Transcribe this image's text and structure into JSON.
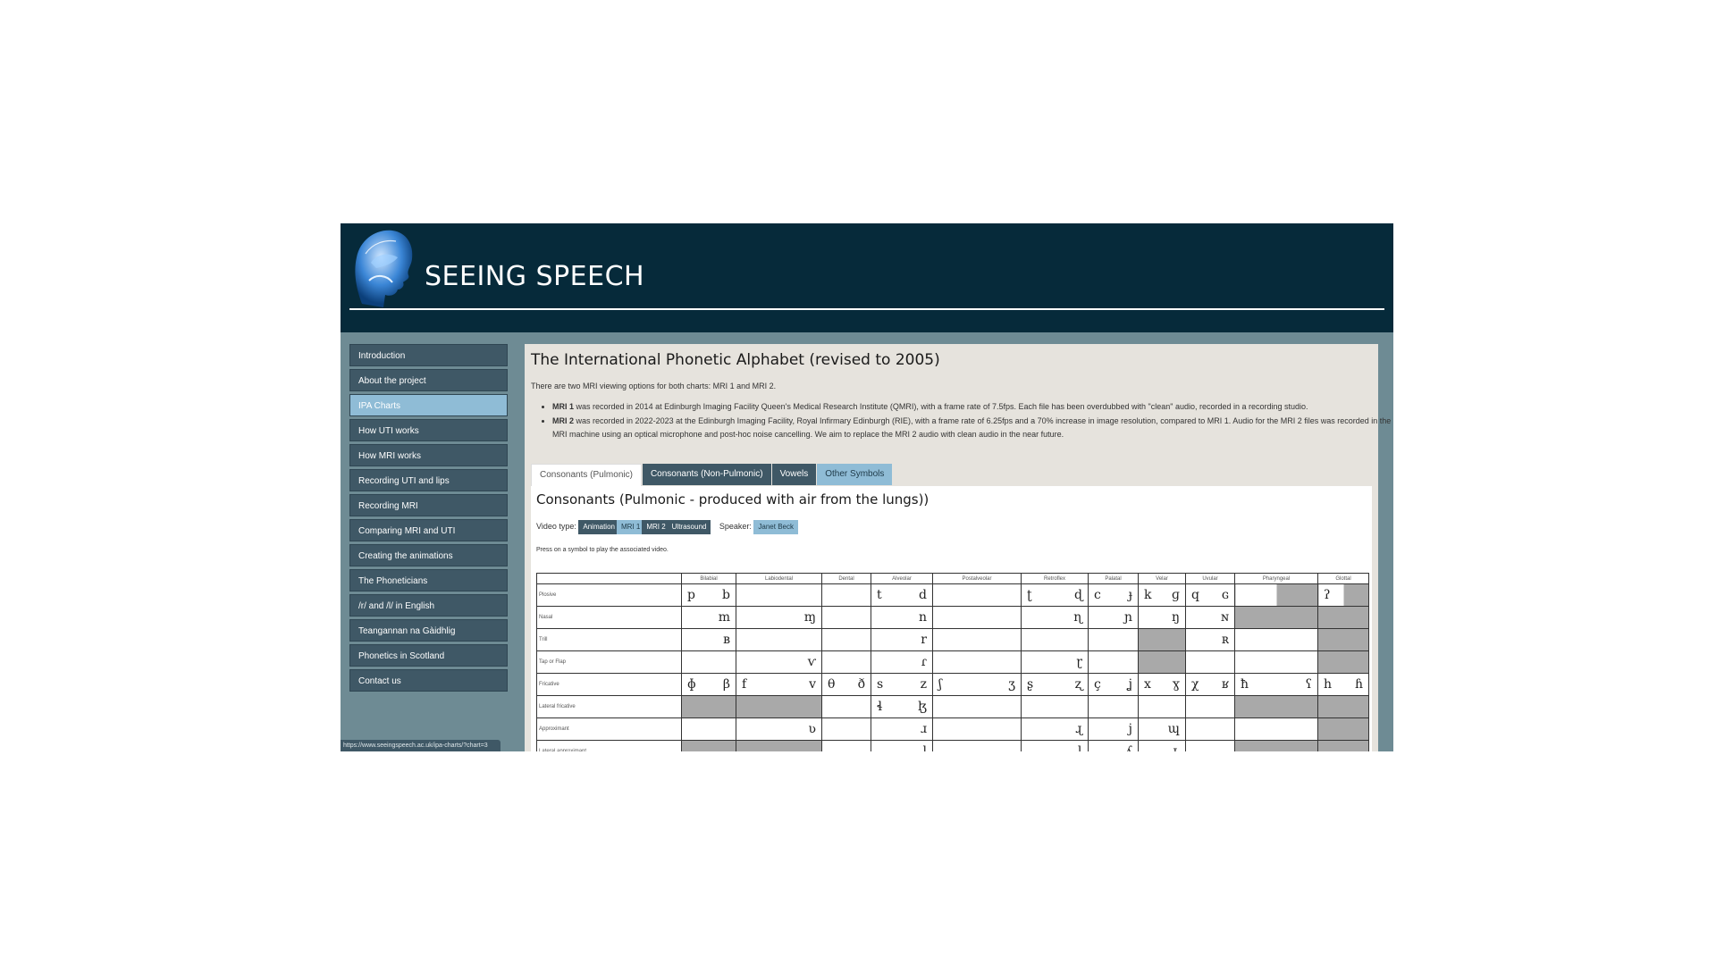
{
  "site": {
    "title": "SEEING SPEECH",
    "status_url": "https://www.seeingspeech.ac.uk/ipa-charts/?chart=3"
  },
  "nav": [
    {
      "label": "Introduction",
      "active": false
    },
    {
      "label": "About the project",
      "active": false
    },
    {
      "label": "IPA Charts",
      "active": true
    },
    {
      "label": "How UTI works",
      "active": false
    },
    {
      "label": "How MRI works",
      "active": false
    },
    {
      "label": "Recording UTI and lips",
      "active": false
    },
    {
      "label": "Recording MRI",
      "active": false
    },
    {
      "label": "Comparing MRI and UTI",
      "active": false
    },
    {
      "label": "Creating the animations",
      "active": false
    },
    {
      "label": "The Phoneticians",
      "active": false
    },
    {
      "label": "/r/ and /l/ in English",
      "active": false
    },
    {
      "label": "Teangannan na Gàidhlig",
      "active": false
    },
    {
      "label": "Phonetics in Scotland",
      "active": false
    },
    {
      "label": "Contact us",
      "active": false
    }
  ],
  "main": {
    "title": "The International Phonetic Alphabet (revised to 2005)",
    "intro": "There are two MRI viewing options for both charts: MRI 1 and MRI 2.",
    "mri1_label": "MRI 1",
    "mri1_text": " was recorded in 2014 at Edinburgh Imaging Facility Queen's Medical Research Institute (QMRI), with a frame rate of 7.5fps. Each file has been overdubbed with \"clean\" audio, recorded in a recording studio.",
    "mri2_label": "MRI 2",
    "mri2_text": " was recorded in 2022-2023 at the Edinburgh Imaging Facility, Royal Infirmary Edinburgh (RIE), with a frame rate of 6.25fps and a 70% increase in image resolution, compared to MRI 1. Audio for the MRI 2 files was recorded in the MRI machine using an optical microphone and post-hoc noise cancelling. We aim to replace the MRI 2 audio with clean audio in the near future."
  },
  "tabs": {
    "pulmonic": "Consonants (Pulmonic)",
    "non_pulmonic": "Consonants (Non-Pulmonic)",
    "vowels": "Vowels",
    "other": "Other Symbols"
  },
  "panel": {
    "title": "Consonants (Pulmonic - produced with air from the lungs))",
    "video_type_label": "Video type:",
    "video_types": [
      "Animation",
      "MRI 1",
      "MRI 2",
      "Ultrasound"
    ],
    "video_type_selected": "MRI 1",
    "speaker_label": "Speaker:",
    "speaker": "Janet Beck",
    "hint": "Press on a symbol to play the associated video."
  },
  "ipa": {
    "columns": [
      "Bilabial",
      "Labiodental",
      "Dental",
      "Alveolar",
      "Postalveolar",
      "Retroflex",
      "Palatal",
      "Velar",
      "Uvular",
      "Pharyngeal",
      "Glottal"
    ],
    "rows": [
      {
        "label": "Plosive",
        "cells": [
          [
            "p",
            "b"
          ],
          [
            "",
            ""
          ],
          [
            "",
            ""
          ],
          [
            "t",
            "d"
          ],
          [
            "",
            ""
          ],
          [
            "ʈ",
            "ɖ"
          ],
          [
            "c",
            "ɟ"
          ],
          [
            "k",
            "ɡ"
          ],
          [
            "q",
            "ɢ"
          ],
          [
            "",
            ""
          ],
          [
            "ʔ",
            ""
          ]
        ],
        "shade": [
          "",
          "",
          "",
          "",
          "",
          "",
          "",
          "",
          "",
          "right",
          "right"
        ]
      },
      {
        "label": "Nasal",
        "cells": [
          [
            "",
            "m"
          ],
          [
            "",
            "ɱ"
          ],
          [
            "",
            ""
          ],
          [
            "",
            "n"
          ],
          [
            "",
            ""
          ],
          [
            "",
            "ɳ"
          ],
          [
            "",
            "ɲ"
          ],
          [
            "",
            "ŋ"
          ],
          [
            "",
            "ɴ"
          ],
          [
            "",
            ""
          ],
          [
            "",
            ""
          ]
        ],
        "shade": [
          "",
          "",
          "",
          "",
          "",
          "",
          "",
          "",
          "",
          "full",
          "full"
        ]
      },
      {
        "label": "Trill",
        "cells": [
          [
            "",
            "ʙ"
          ],
          [
            "",
            ""
          ],
          [
            "",
            ""
          ],
          [
            "",
            "r"
          ],
          [
            "",
            ""
          ],
          [
            "",
            ""
          ],
          [
            "",
            ""
          ],
          [
            "",
            ""
          ],
          [
            "",
            "ʀ"
          ],
          [
            "",
            ""
          ],
          [
            "",
            ""
          ]
        ],
        "shade": [
          "",
          "",
          "",
          "",
          "",
          "",
          "",
          "full",
          "",
          "",
          "full"
        ]
      },
      {
        "label": "Tap or Flap",
        "cells": [
          [
            "",
            ""
          ],
          [
            "",
            "ⱱ"
          ],
          [
            "",
            ""
          ],
          [
            "",
            "ɾ"
          ],
          [
            "",
            ""
          ],
          [
            "",
            "ɽ"
          ],
          [
            "",
            ""
          ],
          [
            "",
            ""
          ],
          [
            "",
            ""
          ],
          [
            "",
            ""
          ],
          [
            "",
            ""
          ]
        ],
        "shade": [
          "",
          "",
          "",
          "",
          "",
          "",
          "",
          "full",
          "",
          "",
          "full"
        ]
      },
      {
        "label": "Fricative",
        "cells": [
          [
            "ɸ",
            "β"
          ],
          [
            "f",
            "v"
          ],
          [
            "θ",
            "ð"
          ],
          [
            "s",
            "z"
          ],
          [
            "ʃ",
            "ʒ"
          ],
          [
            "ʂ",
            "ʐ"
          ],
          [
            "ç",
            "ʝ"
          ],
          [
            "x",
            "ɣ"
          ],
          [
            "χ",
            "ʁ"
          ],
          [
            "ħ",
            "ʕ"
          ],
          [
            "h",
            "ɦ"
          ]
        ],
        "shade": [
          "",
          "",
          "",
          "",
          "",
          "",
          "",
          "",
          "",
          "",
          ""
        ]
      },
      {
        "label": "Lateral fricative",
        "cells": [
          [
            "",
            ""
          ],
          [
            "",
            ""
          ],
          [
            "",
            ""
          ],
          [
            "ɬ",
            "ɮ"
          ],
          [
            "",
            ""
          ],
          [
            "",
            ""
          ],
          [
            "",
            ""
          ],
          [
            "",
            ""
          ],
          [
            "",
            ""
          ],
          [
            "",
            ""
          ],
          [
            "",
            ""
          ]
        ],
        "shade": [
          "full",
          "full",
          "",
          "",
          "",
          "",
          "",
          "",
          "",
          "full",
          "full"
        ]
      },
      {
        "label": "Approximant",
        "cells": [
          [
            "",
            ""
          ],
          [
            "",
            "ʋ"
          ],
          [
            "",
            ""
          ],
          [
            "",
            "ɹ"
          ],
          [
            "",
            ""
          ],
          [
            "",
            "ɻ"
          ],
          [
            "",
            "j"
          ],
          [
            "",
            "ɰ"
          ],
          [
            "",
            ""
          ],
          [
            "",
            ""
          ],
          [
            "",
            ""
          ]
        ],
        "shade": [
          "",
          "",
          "",
          "",
          "",
          "",
          "",
          "",
          "",
          "",
          "full"
        ]
      },
      {
        "label": "Lateral approximant",
        "cells": [
          [
            "",
            ""
          ],
          [
            "",
            ""
          ],
          [
            "",
            ""
          ],
          [
            "",
            "l"
          ],
          [
            "",
            ""
          ],
          [
            "",
            "ɭ"
          ],
          [
            "",
            "ʎ"
          ],
          [
            "",
            "ʟ"
          ],
          [
            "",
            ""
          ],
          [
            "",
            ""
          ],
          [
            "",
            ""
          ]
        ],
        "shade": [
          "full",
          "full",
          "",
          "",
          "",
          "",
          "",
          "",
          "",
          "full",
          "full"
        ]
      }
    ]
  }
}
